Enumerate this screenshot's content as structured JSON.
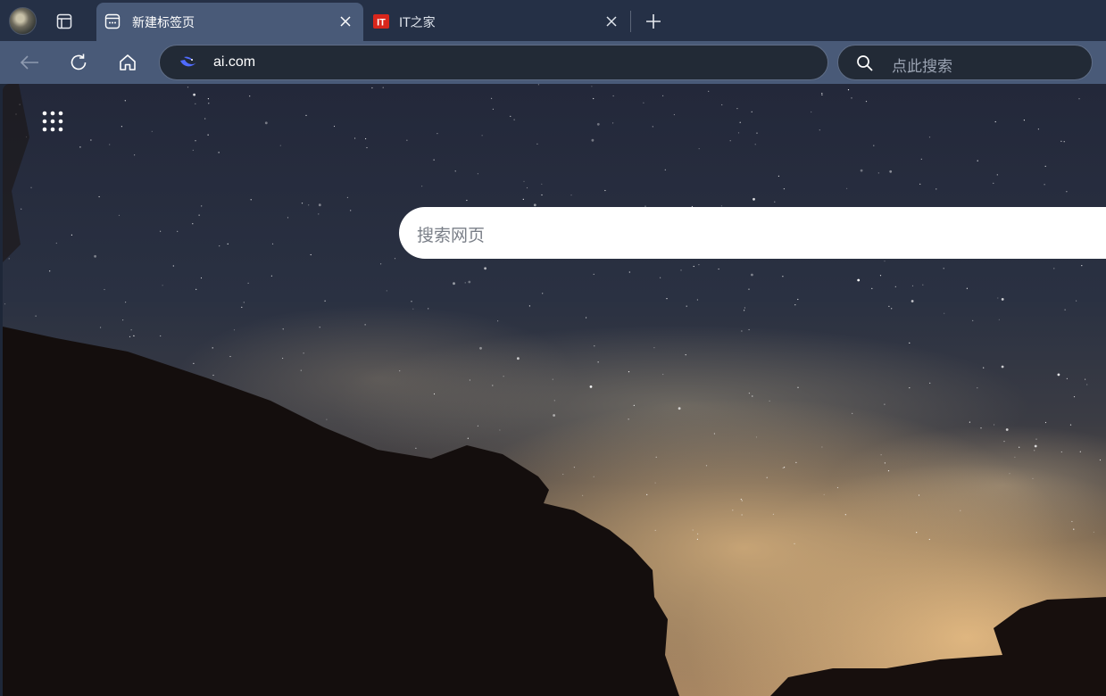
{
  "tabs": [
    {
      "title": "新建标签页",
      "active": true,
      "icon": "new-tab-page-icon"
    },
    {
      "title": "IT之家",
      "active": false,
      "icon": "ithome-favicon"
    }
  ],
  "toolbar": {
    "url": "ai.com",
    "search_placeholder": "点此搜索"
  },
  "page": {
    "search_placeholder": "搜索网页",
    "background": "milky-way-night-sky"
  },
  "colors": {
    "tabstrip": "#253046",
    "active_tab": "#495a78",
    "toolbar": "#495a78",
    "omnibox": "#222a36"
  }
}
